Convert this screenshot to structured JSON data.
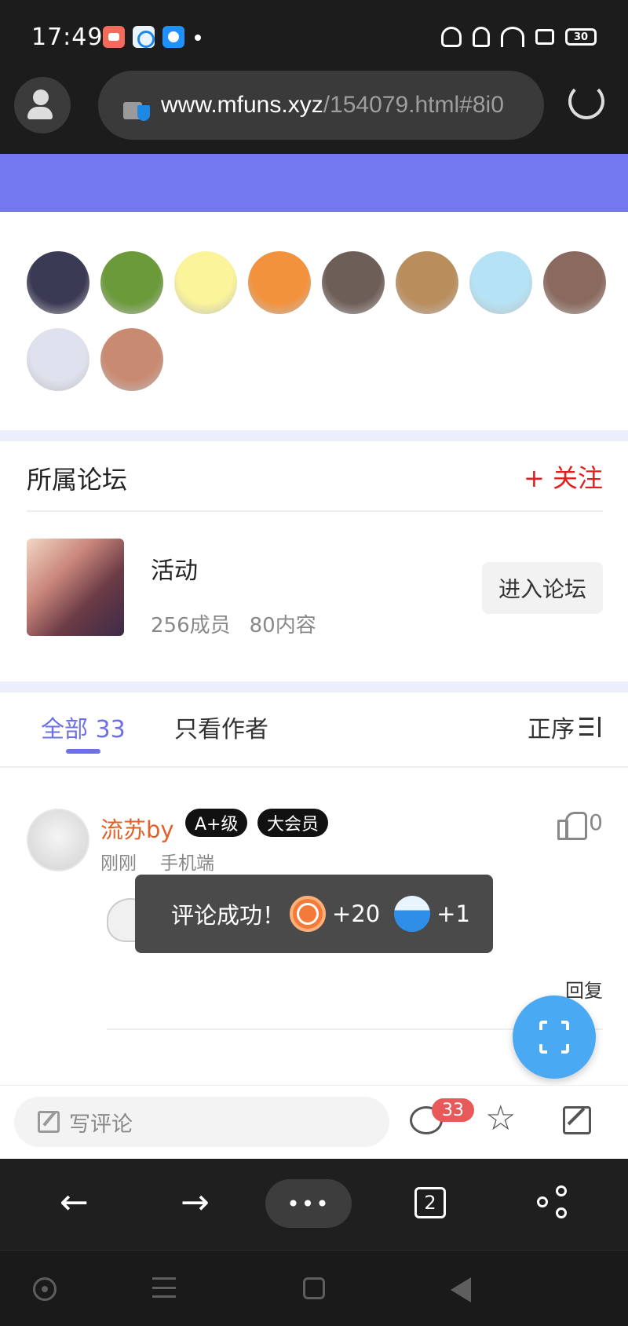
{
  "status_bar": {
    "time": "17:49",
    "battery": "30",
    "app_icons": [
      "game-app-icon",
      "cloud-app-icon",
      "browser-app-icon"
    ],
    "indicator_icons": [
      "headphones-icon",
      "bell-off-icon",
      "wifi-icon",
      "sim-icon",
      "battery-icon"
    ]
  },
  "browser": {
    "url_host": "www.mfuns.xyz",
    "url_path": "/154079.html#8i0",
    "icons": {
      "profile": "profile-add-icon",
      "lock": "lock-shield-icon",
      "reload": "reload-icon"
    }
  },
  "colors": {
    "header": "#7478f0",
    "accent": "#6d70e8",
    "follow_red": "#e02020",
    "username_orange": "#e0612a",
    "fab_blue": "#49a9f3",
    "badge_red": "#e85a5a"
  },
  "likers": {
    "avatar_colors": [
      "#3b3a55",
      "#6b9a3a",
      "#fbf49a",
      "#f3923d",
      "#6e5e58",
      "#b98d5c",
      "#b5e3f5",
      "#8a6a5e",
      "#dfe2ee",
      "#c98a72"
    ]
  },
  "forum": {
    "section_title": "所属论坛",
    "follow_label": "+ 关注",
    "name": "活动",
    "members": "256成员",
    "contents": "80内容",
    "enter_label": "进入论坛"
  },
  "tabs": {
    "all": "全部 33",
    "author_only": "只看作者",
    "sort": "正序"
  },
  "comment": {
    "username": "流苏by",
    "level_badge": "A+级",
    "vip_badge": "大会员",
    "time": "刚刚",
    "device": "手机端",
    "likes": "0",
    "reply_label": "回复"
  },
  "toast": {
    "message": "评论成功！",
    "coin_reward": "+20",
    "exp_reward": "+1",
    "coin_glyph": "币"
  },
  "comment_bar": {
    "placeholder": "写评论",
    "comment_count": "33",
    "icons": [
      "edit-icon",
      "comment-icon",
      "star-icon",
      "share-out-icon"
    ]
  },
  "browser_toolbar": {
    "back_glyph": "←",
    "forward_glyph": "→",
    "menu_glyph": "•••",
    "tab_count": "2"
  }
}
